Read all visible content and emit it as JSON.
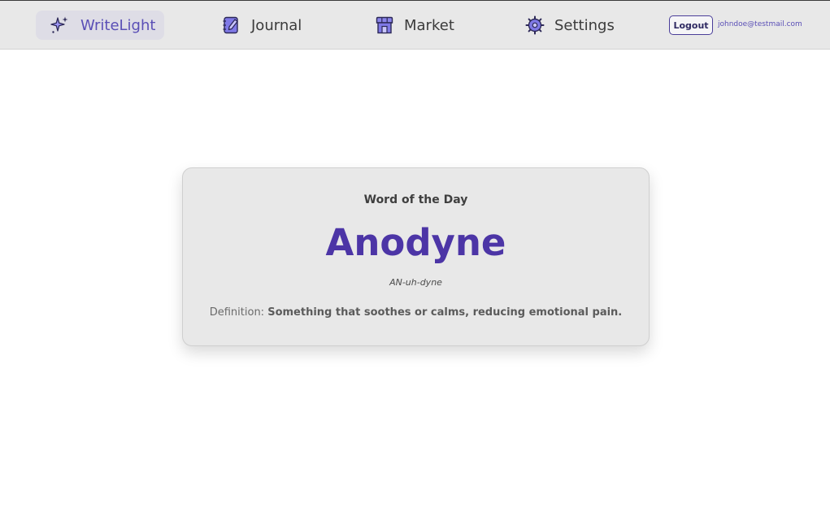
{
  "nav": {
    "brand_label": "WriteLight",
    "journal_label": "Journal",
    "market_label": "Market",
    "settings_label": "Settings",
    "logout_label": "Logout",
    "user_email": "johndoe@testmail.com"
  },
  "icons": {
    "brand": "sparkle-icon",
    "journal": "notebook-pencil-icon",
    "market": "storefront-icon",
    "settings": "gear-icon"
  },
  "colors": {
    "accent": "#5a4fb6",
    "word": "#4c35a6",
    "nav_background": "#e8e8e8",
    "card_background": "#e8e8e8"
  },
  "card": {
    "heading": "Word of the Day",
    "word": "Anodyne",
    "pronunciation": "AN-uh-dyne",
    "definition_label": "Definition:",
    "definition_text": "Something that soothes or calms, reducing emotional pain."
  }
}
